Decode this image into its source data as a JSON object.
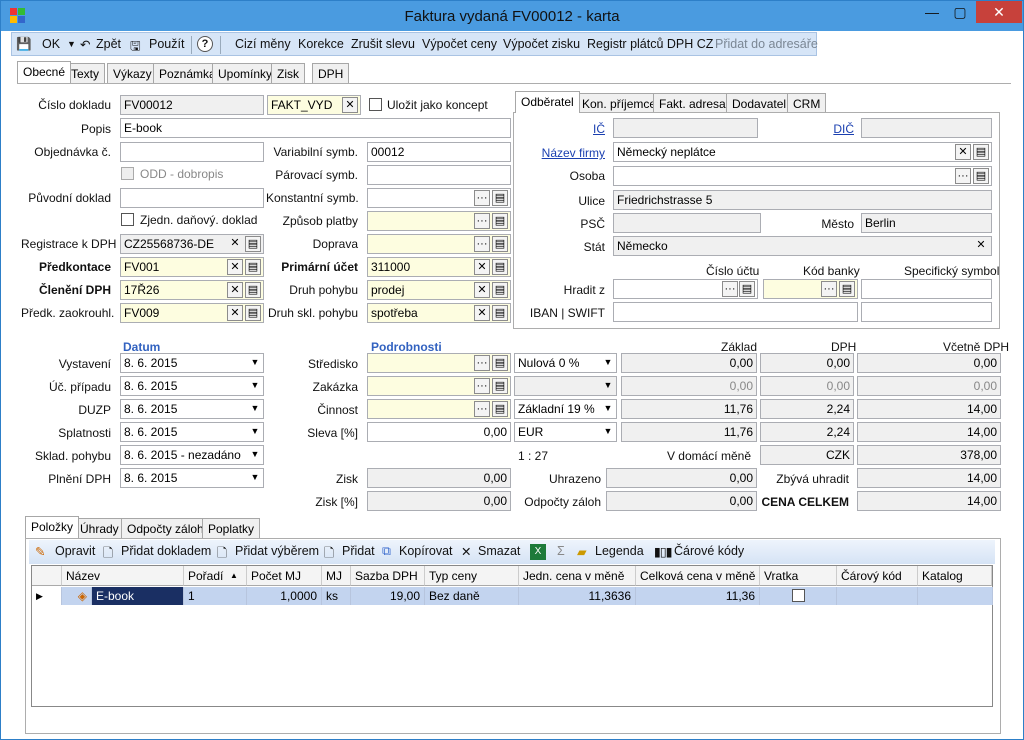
{
  "window": {
    "title": "Faktura vydaná FV00012 - karta",
    "minimize": "—",
    "maximize": "▢",
    "close": "✕"
  },
  "toolbar": {
    "ok": "OK",
    "back": "Zpět",
    "apply": "Použít",
    "help": "?",
    "foreign_currency": "Cizí měny",
    "correction": "Korekce",
    "cancel_discount": "Zrušit slevu",
    "calc_prices": "Výpočet ceny",
    "calc_profit": "Výpočet zisku",
    "vat_register": "Registr plátců DPH CZ",
    "add_address": "Přidat do adresáře"
  },
  "tabs": [
    "Obecné",
    "Texty",
    "Výkazy",
    "Poznámka",
    "Upomínky",
    "Zisk",
    "DPH"
  ],
  "partner_tabs": [
    "Odběratel",
    "Kon. příjemce",
    "Fakt. adresa",
    "Dodavatel",
    "CRM"
  ],
  "bottom_tabs": [
    "Položky",
    "Úhrady",
    "Odpočty záloh",
    "Poplatky"
  ],
  "form": {
    "doc_no_label": "Číslo dokladu",
    "doc_no": "FV00012",
    "doc_type": "FAKT_VYD",
    "save_draft": "Uložit jako koncept",
    "desc_label": "Popis",
    "desc": "E-book",
    "order_label": "Objednávka č.",
    "order": "",
    "var_symbol_label": "Variabilní symb.",
    "var_symbol": "00012",
    "odd_label": "ODD - dobropis",
    "pair_symbol_label": "Párovací symb.",
    "pair_symbol": "",
    "orig_doc_label": "Původní doklad",
    "orig_doc": "",
    "const_symbol_label": "Konstantní symb.",
    "const_symbol": "",
    "simplified_label": "Zjedn. daňový. doklad",
    "payment_label": "Způsob platby",
    "payment": "",
    "vat_reg_label": "Registrace k DPH",
    "vat_reg": "CZ25568736-DE",
    "transport_label": "Doprava",
    "transport": "",
    "precontact_label": "Předkontace",
    "precontact": "FV001",
    "primary_account_label": "Primární účet",
    "primary_account": "311000",
    "vat_split_label": "Členění DPH",
    "vat_split": "17Ř26",
    "movement_label": "Druh pohybu",
    "movement": "prodej",
    "rounding_label": "Předk. zaokrouhl.",
    "rounding": "FV009",
    "stock_movement_label": "Druh skl. pohybu",
    "stock_movement": "spotřeba"
  },
  "partner": {
    "ic_label": "IČ",
    "ic": "",
    "dic_label": "DIČ",
    "dic": "",
    "company_label": "Název firmy",
    "company": "Německý neplátce",
    "person_label": "Osoba",
    "person": "",
    "street_label": "Ulice",
    "street": "Friedrichstrasse 5",
    "zip_label": "PSČ",
    "zip": "",
    "city_label": "Město",
    "city": "Berlin",
    "state_label": "Stát",
    "state": "Německo",
    "account_label": "Číslo účtu",
    "bank_code_label": "Kód banky",
    "specific_symbol_label": "Specifický symbol",
    "pay_from_label": "Hradit z",
    "iban_label": "IBAN | SWIFT"
  },
  "dates": {
    "header": "Datum",
    "issue_label": "Vystavení",
    "issue": "8. 6. 2015",
    "accounting_label": "Úč. případu",
    "accounting": "8. 6. 2015",
    "duzp_label": "DUZP",
    "duzp": "8. 6. 2015",
    "due_label": "Splatnosti",
    "due": "8. 6. 2015",
    "stock_label": "Sklad. pohybu",
    "stock": "8. 6. 2015 - nezadáno",
    "vat_fulfil_label": "Plnění DPH",
    "vat_fulfil": "8. 6. 2015"
  },
  "details": {
    "header": "Podrobnosti",
    "center_label": "Středisko",
    "contract_label": "Zakázka",
    "activity_label": "Činnost",
    "discount_label": "Sleva [%]",
    "discount": "0,00",
    "profit_label": "Zisk",
    "profit": "0,00",
    "profit_pct_label": "Zisk [%]",
    "profit_pct": "0,00"
  },
  "totals": {
    "base_label": "Základ",
    "vat_label": "DPH",
    "incl_vat_label": "Včetně DPH",
    "rows": [
      {
        "rate": "Nulová 0 %",
        "base": "0,00",
        "vat": "0,00",
        "total": "0,00"
      },
      {
        "rate": "",
        "base": "0,00",
        "vat": "0,00",
        "total": "0,00"
      },
      {
        "rate": "Základní 19 %",
        "base": "11,76",
        "vat": "2,24",
        "total": "14,00"
      },
      {
        "rate": "EUR",
        "base": "11,76",
        "vat": "2,24",
        "total": "14,00"
      }
    ],
    "exchange": "1 : 27",
    "domestic_label": "V domácí měně",
    "domestic_currency": "CZK",
    "domestic_total": "378,00",
    "paid_label": "Uhrazeno",
    "paid": "0,00",
    "remaining_label": "Zbývá uhradit",
    "remaining": "14,00",
    "advance_label": "Odpočty záloh",
    "advance": "0,00",
    "grand_label": "CENA CELKEM",
    "grand": "14,00"
  },
  "items_toolbar": {
    "edit": "Opravit",
    "add_doc": "Přidat dokladem",
    "add_select": "Přidat výběrem",
    "add": "Přidat",
    "copy": "Kopírovat",
    "delete": "Smazat",
    "legend": "Legenda",
    "barcodes": "Čárové kódy",
    "sum": "Σ"
  },
  "grid": {
    "columns": [
      "Název",
      "Pořadí",
      "Počet MJ",
      "MJ",
      "Sazba DPH",
      "Typ ceny",
      "Jedn. cena v měně",
      "Celková cena v měně",
      "Vratka",
      "Čárový kód",
      "Katalog"
    ],
    "rows": [
      {
        "name": "E-book",
        "order": "1",
        "qty": "1,0000",
        "unit": "ks",
        "vat": "19,00",
        "price_type": "Bez daně",
        "unit_price": "11,3636",
        "total_price": "11,36"
      }
    ]
  },
  "colors": {
    "accent": "#3262c0",
    "yellow": "#fdfde0",
    "title": "#4a9be0"
  }
}
